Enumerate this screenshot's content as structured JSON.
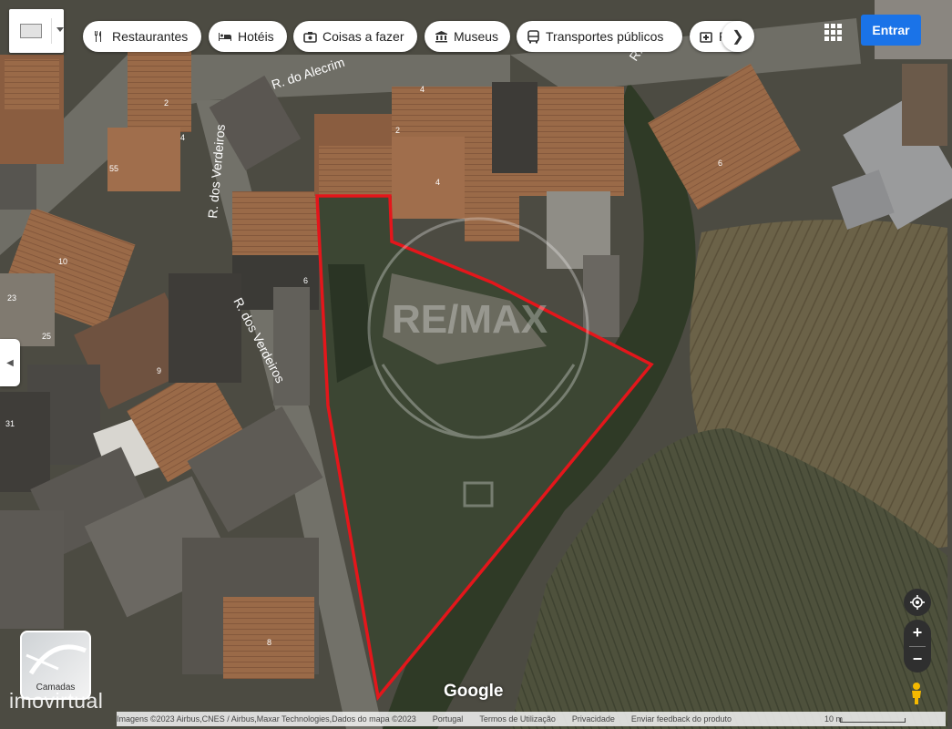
{
  "toolbar": {
    "chips": [
      {
        "label": "Restaurantes",
        "icon": "restaurant-icon"
      },
      {
        "label": "Hotéis",
        "icon": "bed-icon"
      },
      {
        "label": "Coisas a fazer",
        "icon": "camera-icon"
      },
      {
        "label": "Museus",
        "icon": "museum-icon"
      },
      {
        "label": "Transportes públicos",
        "icon": "bus-icon"
      },
      {
        "label": "F",
        "icon": "pharmacy-icon"
      }
    ],
    "signin_label": "Entrar",
    "next_icon": "chevron-right-icon"
  },
  "map": {
    "streets": [
      "R. do Alecrim",
      "R. dos Verdeiros",
      "R. dos Verdeiros",
      "R."
    ],
    "house_numbers": [
      "4",
      "2",
      "4",
      "2",
      "4",
      "55",
      "10",
      "23",
      "25",
      "9",
      "31",
      "6",
      "6",
      "8"
    ],
    "watermark": "RE/MAX",
    "highlight_color": "#e4161b"
  },
  "layers_thumb_label": "Camadas",
  "google_label": "Google",
  "brand_label": "imovirtual",
  "footer": {
    "attribution": "Imagens ©2023 Airbus,CNES / Airbus,Maxar Technologies,Dados do mapa ©2023",
    "country": "Portugal",
    "terms": "Termos de Utilização",
    "privacy": "Privacidade",
    "feedback": "Enviar feedback do produto",
    "scale": "10 m"
  }
}
